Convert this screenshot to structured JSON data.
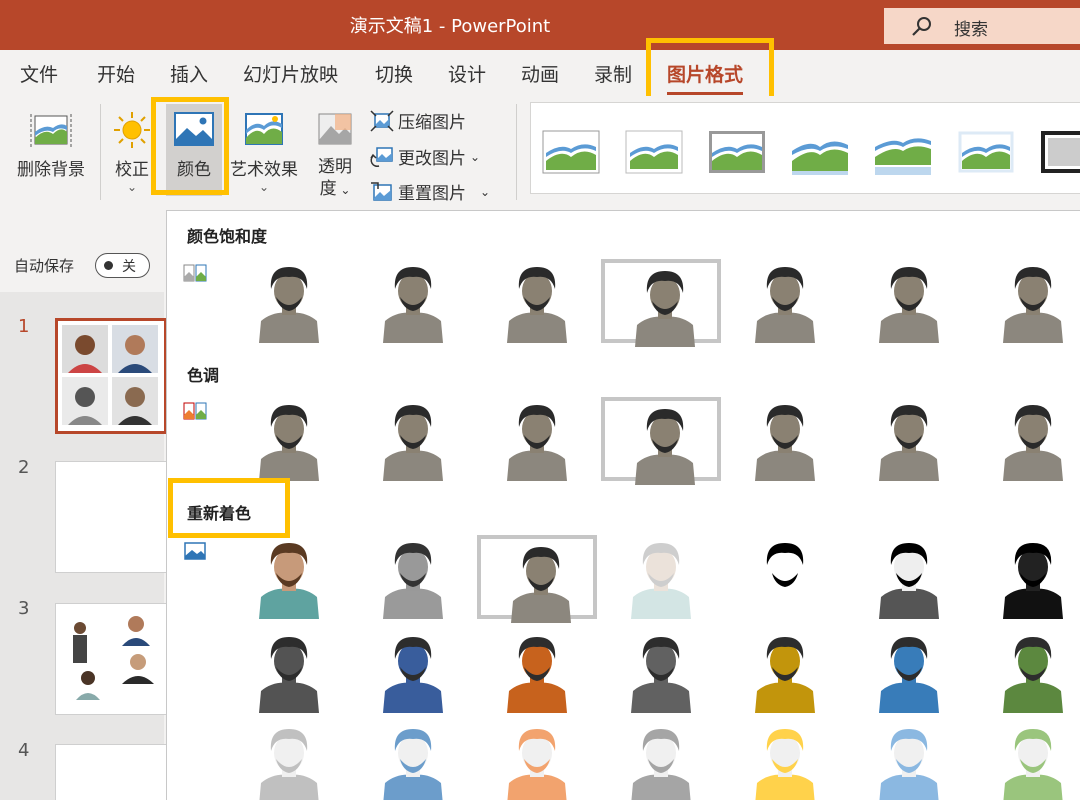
{
  "window": {
    "title": "演示文稿1  -  PowerPoint"
  },
  "search": {
    "label": "搜索",
    "icon": "search-icon"
  },
  "tabs": [
    {
      "label": "文件"
    },
    {
      "label": "开始"
    },
    {
      "label": "插入"
    },
    {
      "label": "幻灯片放映"
    },
    {
      "label": "切换"
    },
    {
      "label": "设计"
    },
    {
      "label": "动画"
    },
    {
      "label": "录制"
    },
    {
      "label": "图片格式",
      "active": true
    }
  ],
  "ribbon": {
    "remove_bg": "删除背景",
    "corrections": "校正",
    "color": "颜色",
    "artistic": "艺术效果",
    "transparency_1": "透明",
    "transparency_2": "度",
    "compress": "压缩图片",
    "change": "更改图片",
    "reset": "重置图片"
  },
  "autosave": {
    "label": "自动保存",
    "toggle_value": "关"
  },
  "slides": [
    {
      "number": "1"
    },
    {
      "number": "2"
    },
    {
      "number": "3"
    },
    {
      "number": "4"
    }
  ],
  "color_menu": {
    "saturation_title": "颜色饱和度",
    "tone_title": "色调",
    "recolor_title": "重新着色"
  },
  "colors": {
    "accent": "#b7472a",
    "highlight": "#ffc000",
    "recolor_tints": [
      "#4a4a4a",
      "#2f5597",
      "#c55a11",
      "#595959",
      "#bf9000",
      "#2e75b6",
      "#548235"
    ],
    "recolor_light": [
      "#a6a6a6",
      "#2e75b6",
      "#ed7d31",
      "#7f7f7f",
      "#ffc000",
      "#5b9bd5",
      "#70ad47"
    ]
  }
}
